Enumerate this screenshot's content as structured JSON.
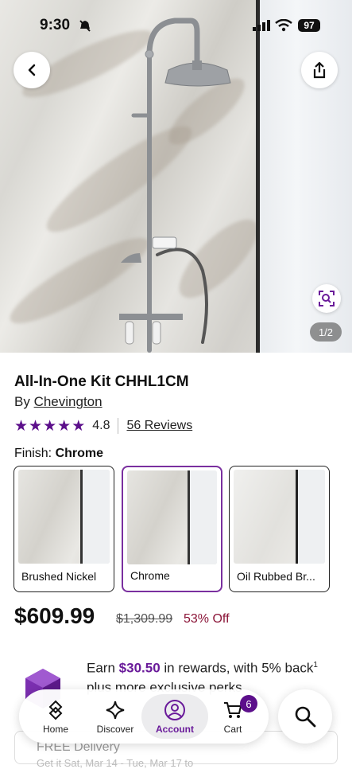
{
  "status_bar": {
    "time": "9:30",
    "battery": "97"
  },
  "gallery": {
    "pager": "1/2"
  },
  "product": {
    "title": "All-In-One Kit CHHL1CM",
    "by_prefix": "By",
    "brand": "Chevington",
    "rating": "4.8",
    "stars": 5,
    "reviews": "56 Reviews",
    "finish_label": "Finish:",
    "finish_value": "Chrome"
  },
  "swatches": [
    {
      "label": "Brushed Nickel",
      "selected": false
    },
    {
      "label": "Chrome",
      "selected": true
    },
    {
      "label": "Oil Rubbed Br...",
      "selected": false
    }
  ],
  "pricing": {
    "price": "$609.99",
    "original": "$1,309.99",
    "discount": "53% Off"
  },
  "rewards": {
    "pre": "Earn",
    "amount": "$30.50",
    "post": "in rewards, with 5% back",
    "sup": "1",
    "line2": "plus more exclusive perks"
  },
  "delivery": {
    "title": "FREE Delivery",
    "sub": "Get it Sat, Mar 14 - Tue, Mar 17 to"
  },
  "nav": {
    "home": "Home",
    "discover": "Discover",
    "account": "Account",
    "cart": "Cart",
    "cart_count": "6"
  },
  "colors": {
    "accent": "#5c0f8b",
    "discount": "#8b1538"
  },
  "icons": [
    "back-arrow-icon",
    "share-icon",
    "zoom-search-icon",
    "star-icon",
    "home-icon",
    "discover-sparkle-icon",
    "account-icon",
    "cart-icon",
    "search-icon"
  ]
}
